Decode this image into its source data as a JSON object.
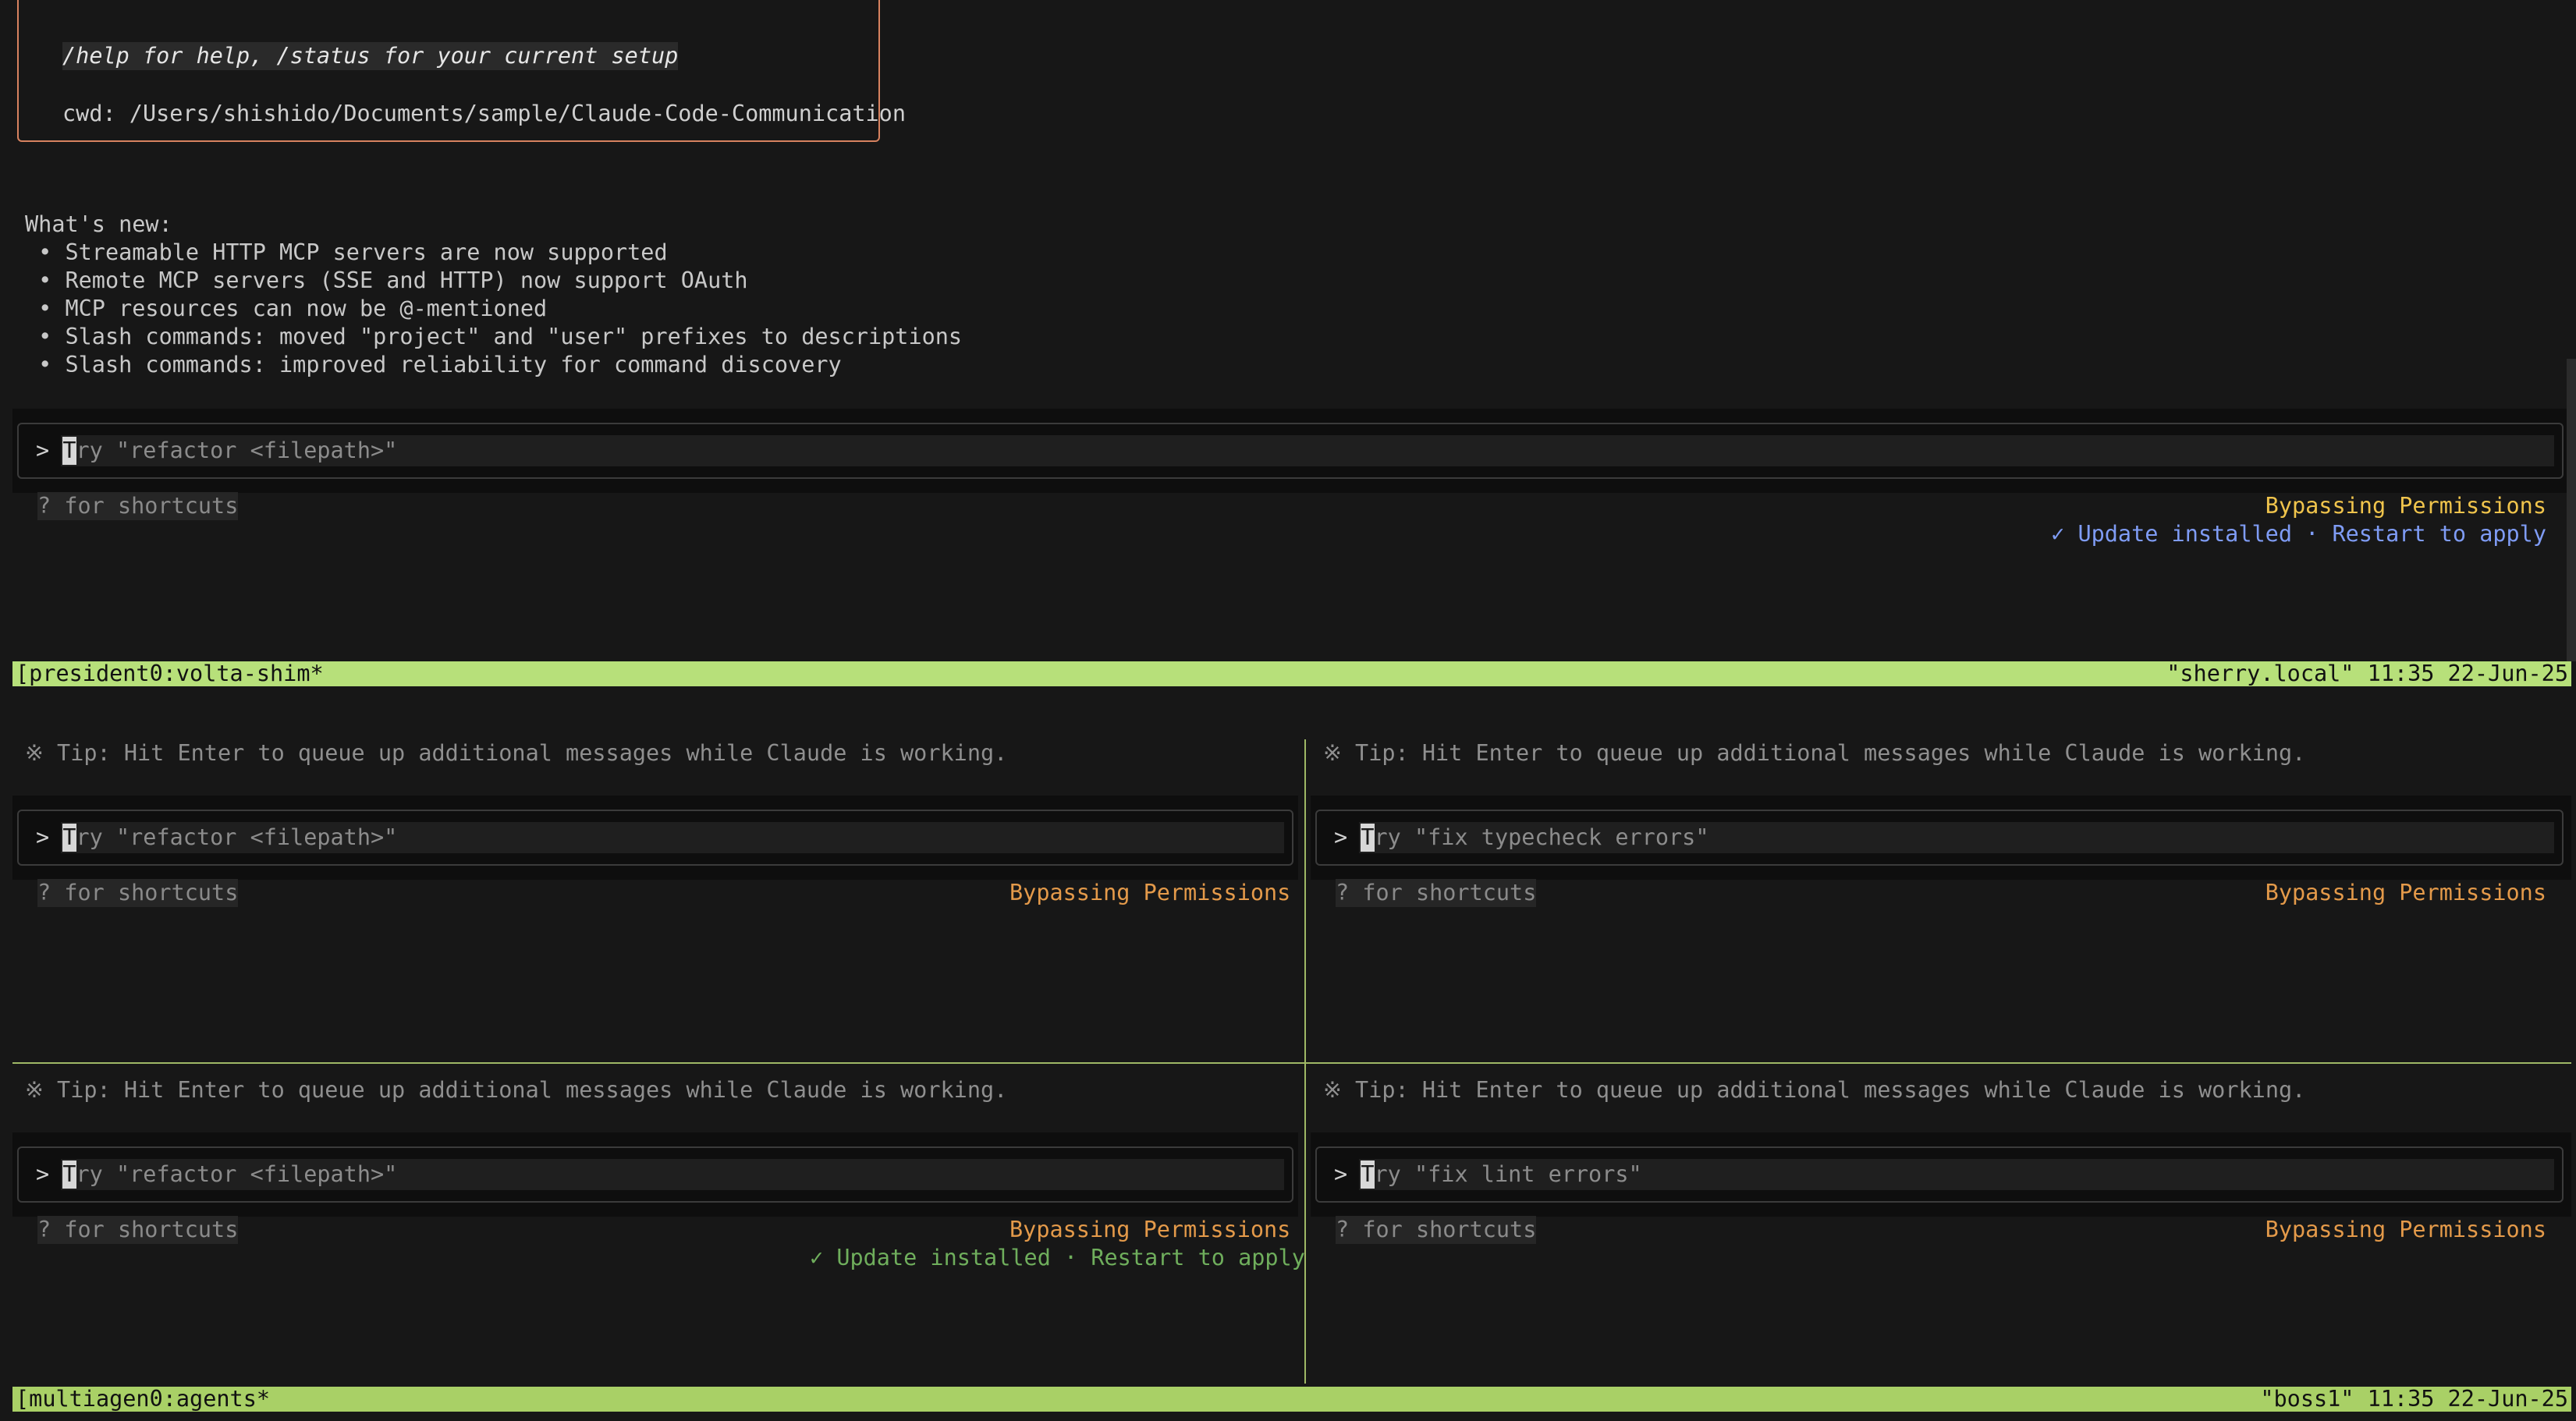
{
  "colors": {
    "status_bar_top": "#b7e07a",
    "status_bar_bottom": "#a9d066",
    "welcome_border": "#d7825f",
    "bypass_yellow": "#f0c44c",
    "bypass_orange": "#e49a4a",
    "update_blue": "#7f9cf5",
    "update_green": "#6fae5c",
    "pane_divider": "#9fb866"
  },
  "welcome": {
    "help_text": "/help for help, /status for your current setup",
    "cwd_text": "cwd: /Users/shishido/Documents/sample/Claude-Code-Communication"
  },
  "whats_new": {
    "title": "What's new:",
    "items": [
      " • Streamable HTTP MCP servers are now supported",
      " • Remote MCP servers (SSE and HTTP) now support OAuth",
      " • MCP resources can now be @-mentioned",
      " • Slash commands: moved \"project\" and \"user\" prefixes to descriptions",
      " • Slash commands: improved reliability for command discovery"
    ]
  },
  "top_pane": {
    "prompt_symbol": ">",
    "cursor_char": "T",
    "placeholder": "ry \"refactor <filepath>\"",
    "shortcuts_hint": "? for shortcuts",
    "mode_label": "Bypassing Permissions",
    "update_notice": "✓ Update installed · Restart to apply"
  },
  "status_bar_top": {
    "left": "[president0:volta-shim*",
    "right": "\"sherry.local\" 11:35 22-Jun-25"
  },
  "panes": [
    {
      "tip": "※ Tip: Hit Enter to queue up additional messages while Claude is working.",
      "prompt_symbol": ">",
      "cursor_char": "T",
      "placeholder": "ry \"refactor <filepath>\"",
      "shortcuts_hint": "? for shortcuts",
      "mode_label": "Bypassing Permissions",
      "update_notice": ""
    },
    {
      "tip": "※ Tip: Hit Enter to queue up additional messages while Claude is working.",
      "prompt_symbol": ">",
      "cursor_char": "T",
      "placeholder": "ry \"fix typecheck errors\"",
      "shortcuts_hint": "? for shortcuts",
      "mode_label": "Bypassing Permissions",
      "update_notice": ""
    },
    {
      "tip": "※ Tip: Hit Enter to queue up additional messages while Claude is working.",
      "prompt_symbol": ">",
      "cursor_char": "T",
      "placeholder": "ry \"refactor <filepath>\"",
      "shortcuts_hint": "? for shortcuts",
      "mode_label": "Bypassing Permissions",
      "update_notice": "✓ Update installed · Restart to apply"
    },
    {
      "tip": "※ Tip: Hit Enter to queue up additional messages while Claude is working.",
      "prompt_symbol": ">",
      "cursor_char": "T",
      "placeholder": "ry \"fix lint errors\"",
      "shortcuts_hint": "? for shortcuts",
      "mode_label": "Bypassing Permissions",
      "update_notice": ""
    }
  ],
  "status_bar_bottom": {
    "left": "[multiagen0:agents*",
    "right": "\"boss1\" 11:35 22-Jun-25"
  }
}
